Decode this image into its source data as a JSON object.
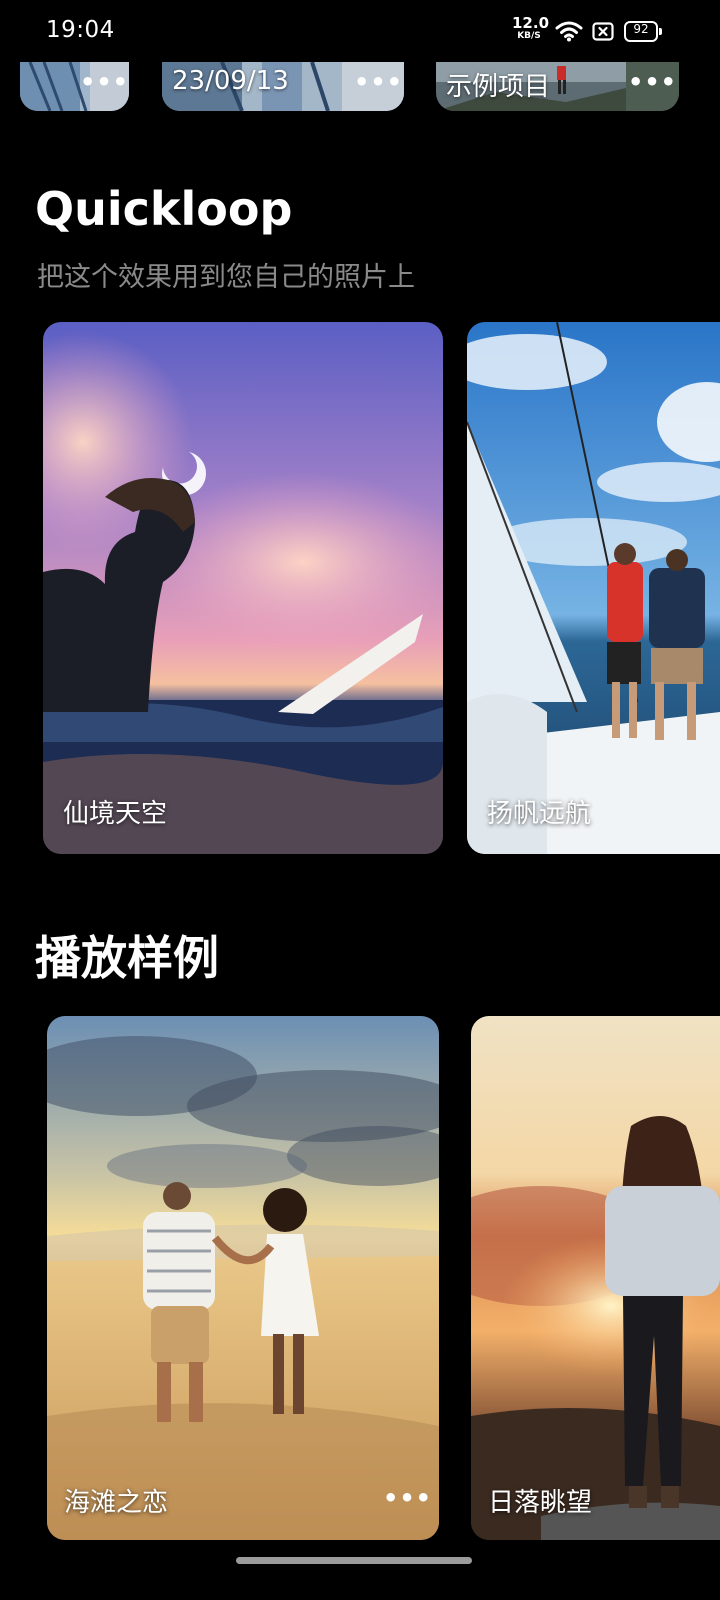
{
  "status_bar": {
    "time": "19:04",
    "net_speed_value": "12.0",
    "net_speed_unit": "KB/S",
    "battery_level": "92",
    "icons": [
      "wifi-icon",
      "sim-no-signal-icon",
      "battery-icon"
    ]
  },
  "projects": {
    "items": [
      {
        "label": "",
        "more": "•••"
      },
      {
        "label": "23/09/13",
        "more": "•••"
      },
      {
        "label": "示例项目",
        "more": "•••"
      }
    ]
  },
  "quickloop": {
    "title": "Quickloop",
    "subtitle": "把这个效果用到您自己的照片上",
    "cards": [
      {
        "label": "仙境天空"
      },
      {
        "label": "扬帆远航"
      }
    ]
  },
  "samples": {
    "title": "播放样例",
    "cards": [
      {
        "label": "海滩之恋",
        "more": "•••"
      },
      {
        "label": "日落眺望"
      }
    ]
  },
  "colors": {
    "background": "#000000",
    "subtitle_gray": "#8a8a8a"
  }
}
